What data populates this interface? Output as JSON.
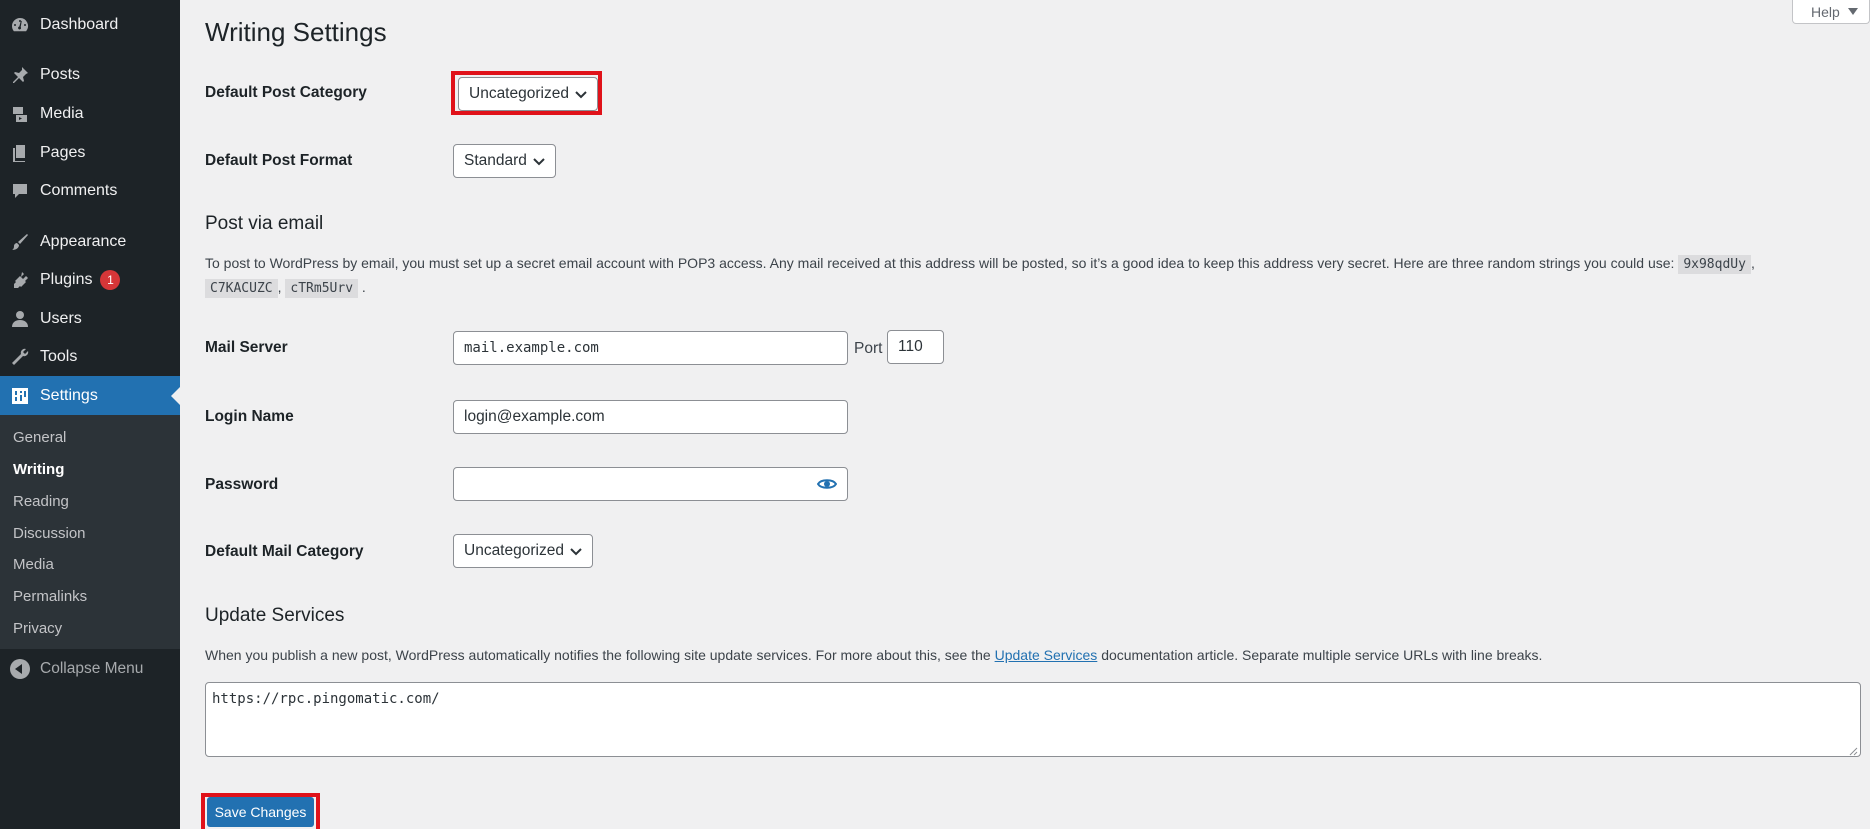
{
  "sidebar": {
    "items": [
      {
        "label": "Dashboard",
        "icon": "dashboard-icon"
      },
      {
        "label": "Posts",
        "icon": "pushpin-icon"
      },
      {
        "label": "Media",
        "icon": "media-icon"
      },
      {
        "label": "Pages",
        "icon": "pages-icon"
      },
      {
        "label": "Comments",
        "icon": "comments-icon"
      },
      {
        "label": "Appearance",
        "icon": "paintbrush-icon"
      },
      {
        "label": "Plugins",
        "icon": "plugin-icon",
        "badge": "1"
      },
      {
        "label": "Users",
        "icon": "users-icon"
      },
      {
        "label": "Tools",
        "icon": "wrench-icon"
      },
      {
        "label": "Settings",
        "icon": "settings-icon",
        "active": true
      }
    ],
    "submenu": [
      "General",
      "Writing",
      "Reading",
      "Discussion",
      "Media",
      "Permalinks",
      "Privacy"
    ],
    "current_submenu": "Writing",
    "collapse_label": "Collapse Menu"
  },
  "help": {
    "label": "Help"
  },
  "page": {
    "title": "Writing Settings",
    "default_post_category": {
      "label": "Default Post Category",
      "value": "Uncategorized"
    },
    "default_post_format": {
      "label": "Default Post Format",
      "value": "Standard"
    },
    "post_via_email": {
      "heading": "Post via email",
      "desc_text": "To post to WordPress by email, you must set up a secret email account with POP3 access. Any mail received at this address will be posted, so it’s a good idea to keep this address very secret. Here are three random strings you could use:",
      "codes": [
        "9x98qdUy",
        "C7KACUZC",
        "cTRm5Urv"
      ],
      "sep1": ",",
      "sep2": ",",
      "end": "."
    },
    "mail_server": {
      "label": "Mail Server",
      "value": "mail.example.com",
      "port_label": "Port",
      "port_value": "110"
    },
    "login_name": {
      "label": "Login Name",
      "value": "login@example.com"
    },
    "password": {
      "label": "Password",
      "value": ""
    },
    "default_mail_category": {
      "label": "Default Mail Category",
      "value": "Uncategorized"
    },
    "update_services": {
      "heading": "Update Services",
      "desc_before": "When you publish a new post, WordPress automatically notifies the following site update services. For more about this, see the",
      "link_text": "Update Services",
      "desc_after": "documentation article. Separate multiple service URLs with line breaks.",
      "textarea_value": "https://rpc.pingomatic.com/"
    },
    "save_button": "Save Changes"
  },
  "colors": {
    "accent": "#2271b1",
    "highlight": "#e0121a",
    "sidebar_bg": "#1d2327",
    "badge": "#d63638"
  }
}
